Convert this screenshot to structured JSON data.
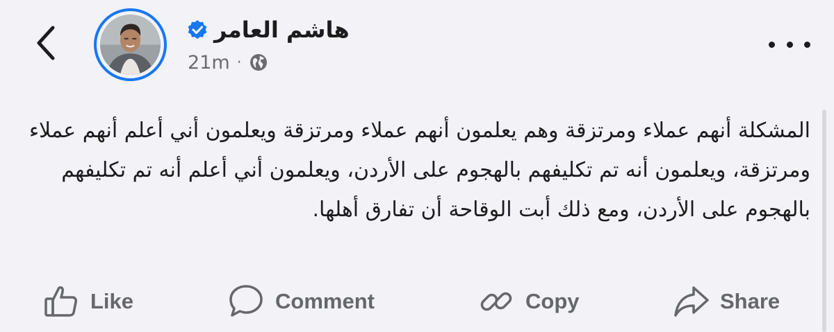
{
  "header": {
    "back_icon": "chevron-left-icon",
    "author_name": "هاشم العامر",
    "verified_icon": "verified-badge-icon",
    "timestamp": "21m",
    "separator": "·",
    "audience_icon": "globe-icon",
    "more_icon": "more-horizontal-icon"
  },
  "post": {
    "text": "المشكلة أنهم عملاء ومرتزقة وهم يعلمون أنهم عملاء ومرتزقة ويعلمون أني أعلم أنهم عملاء ومرتزقة، ويعلمون أنه تم تكليفهم بالهجوم على الأردن، ويعلمون أني أعلم أنه تم تكليفهم بالهجوم على الأردن، ومع ذلك أبت الوقاحة أن تفارق أهلها."
  },
  "actions": [
    {
      "label": "Like",
      "icon": "thumbs-up-icon"
    },
    {
      "label": "Comment",
      "icon": "comment-bubble-icon"
    },
    {
      "label": "Copy",
      "icon": "link-icon"
    },
    {
      "label": "Share",
      "icon": "share-arrow-icon"
    }
  ],
  "colors": {
    "background": "#f2f2f7",
    "accent": "#1877f2",
    "text": "#1c1c1e",
    "muted": "#65676b"
  }
}
